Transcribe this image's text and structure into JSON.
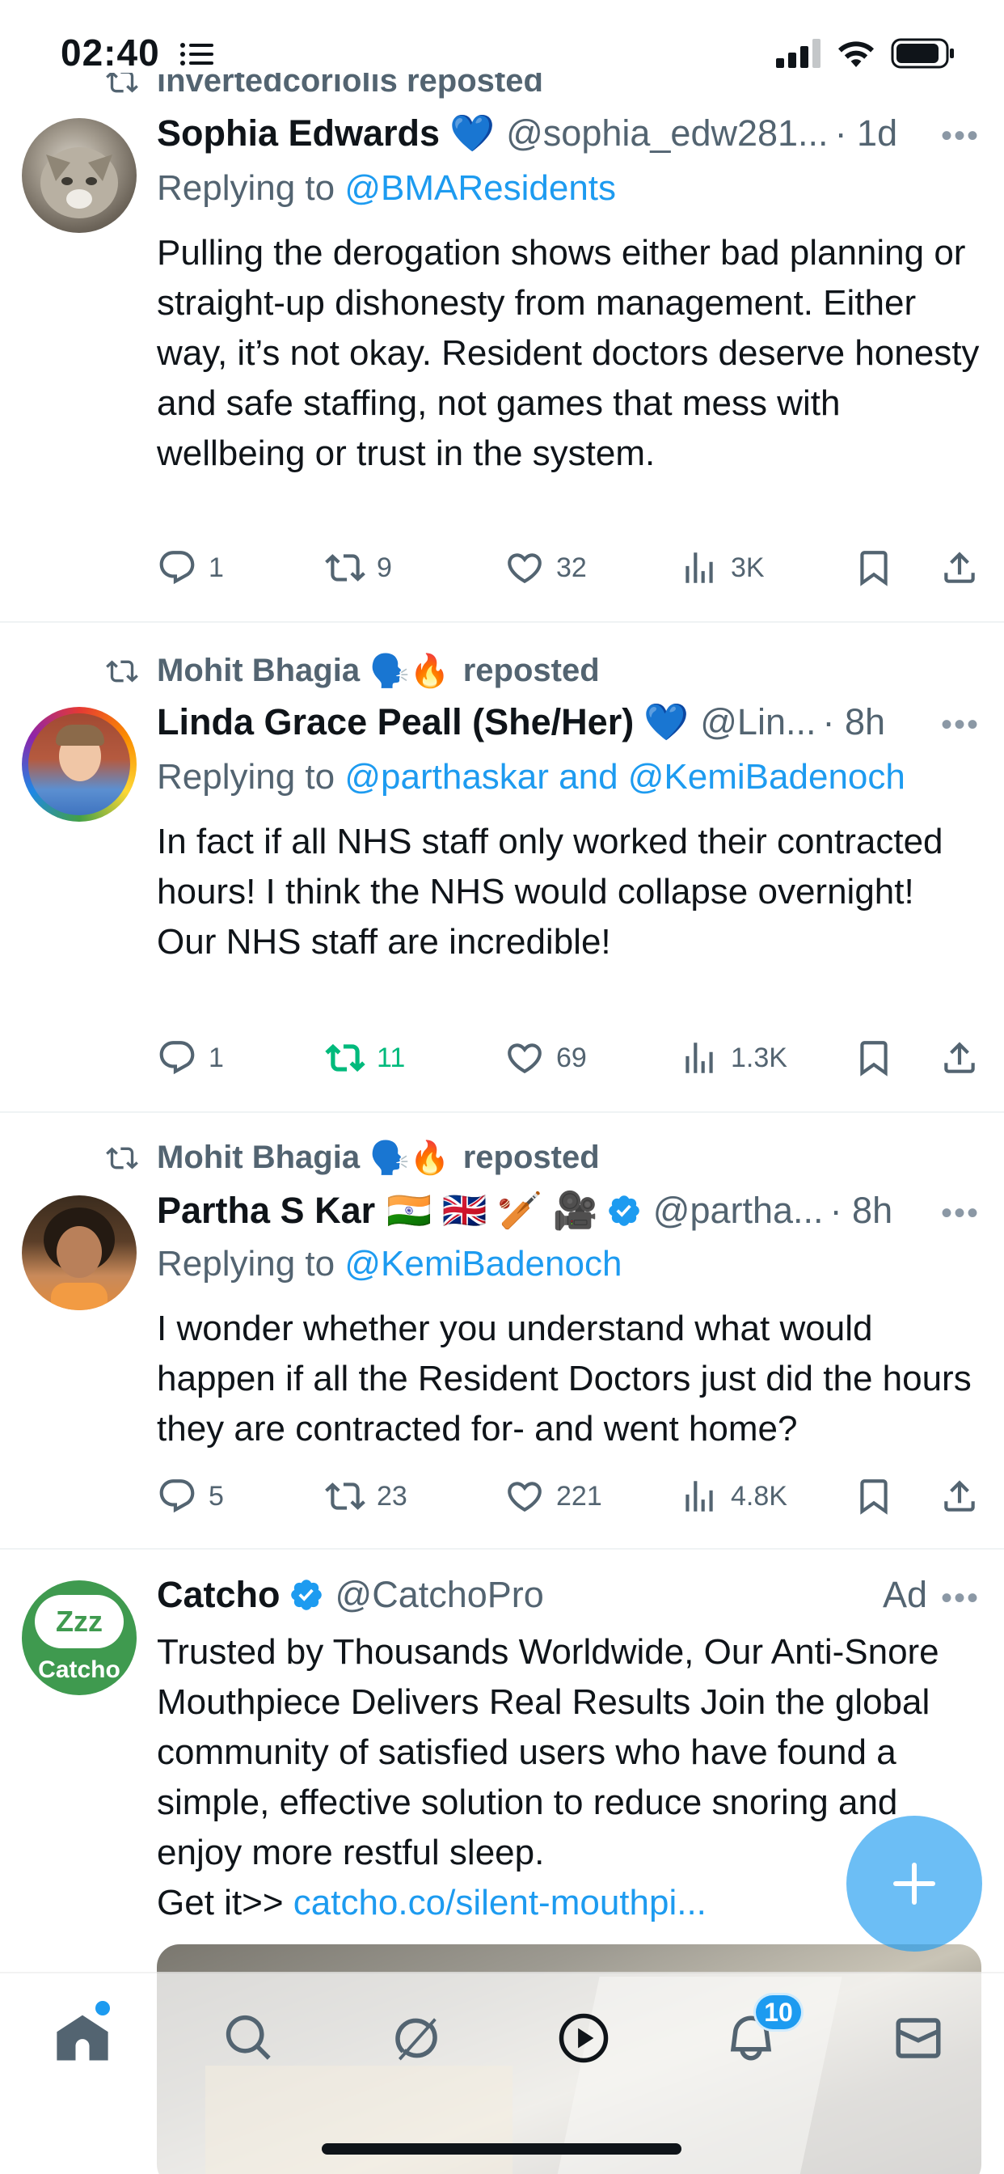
{
  "status_bar": {
    "time": "02:40"
  },
  "tweets": [
    {
      "social_context": "invertedcoriolis reposted",
      "name": "Sophia Edwards",
      "name_emoji": "💙",
      "handle": "@sophia_edw281...",
      "time": "· 1d",
      "replying_prefix": "Replying to ",
      "replying_to": "@BMAResidents",
      "text": "Pulling the derogation shows either bad planning or straight-up dishonesty from management. Either way, it’s not okay. Resident doctors deserve honesty and safe staffing, not games that mess with wellbeing or trust in the system.",
      "replies": "1",
      "reposts": "9",
      "likes": "32",
      "views": "3K"
    },
    {
      "social_context_name": "Mohit Bhagia",
      "social_context_emojis": "🗣️🔥",
      "social_context_suffix": "reposted",
      "name": "Linda Grace Peall (She/Her)",
      "name_emoji": "💙",
      "handle": "@Lin...",
      "time": "· 8h",
      "replying_prefix": "Replying to ",
      "replying_to": "@parthaskar and @KemiBadenoch",
      "text": "In fact if all NHS staff only worked their contracted hours! I think the NHS would collapse overnight! Our NHS staff are incredible!",
      "replies": "1",
      "reposts": "11",
      "likes": "69",
      "views": "1.3K"
    },
    {
      "social_context_name": "Mohit Bhagia",
      "social_context_emojis": "🗣️🔥",
      "social_context_suffix": "reposted",
      "name": "Partha S Kar",
      "name_emoji": "🇮🇳 🇬🇧 🏏 🎥",
      "handle": "@partha...",
      "time": "· 8h",
      "replying_prefix": "Replying to ",
      "replying_to": "@KemiBadenoch",
      "text": "I wonder whether you understand what would happen if all the Resident Doctors just did the hours they are contracted for- and went home?",
      "replies": "5",
      "reposts": "23",
      "likes": "221",
      "views": "4.8K"
    },
    {
      "name": "Catcho",
      "handle": "@CatchoPro",
      "ad_label": "Ad",
      "avatar_text_1": "Zzz",
      "avatar_text_2": "Catcho",
      "text": "Trusted by Thousands Worldwide, Our Anti-Snore Mouthpiece Delivers Real Results Join the global community of satisfied users who have found a simple, effective solution to reduce snoring and enjoy more restful sleep.",
      "cta_prefix": "Get it>> ",
      "cta_link": "catcho.co/silent-mouthpi..."
    }
  ],
  "tabbar": {
    "notifications_count": "10"
  },
  "colors": {
    "accent": "#1d9bf0",
    "text": "#0f1419",
    "muted": "#536471",
    "repost_green": "#00ba7c"
  }
}
